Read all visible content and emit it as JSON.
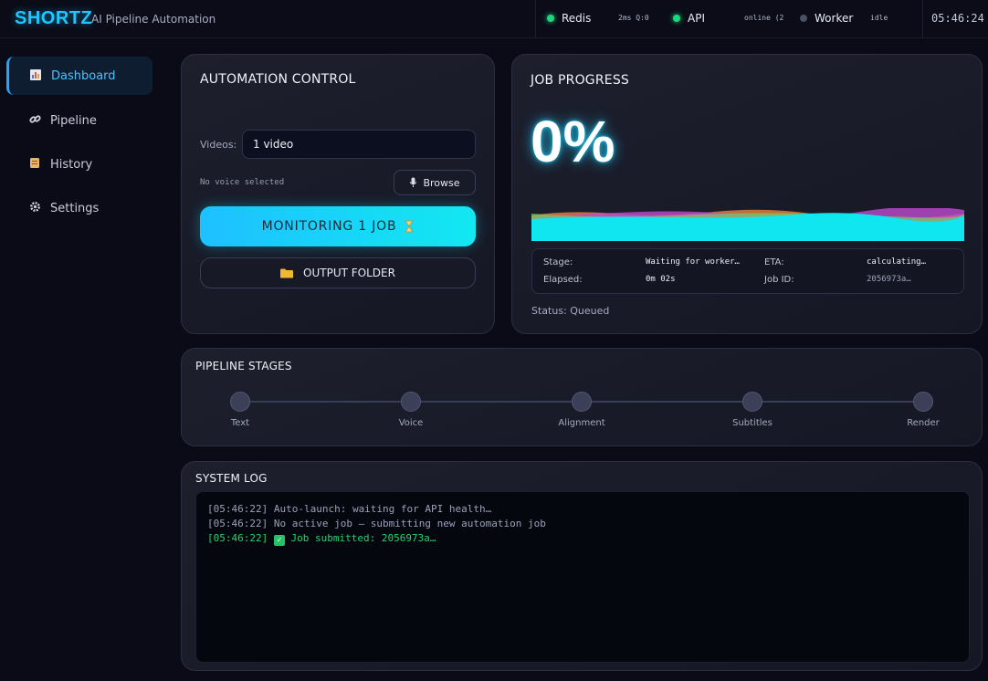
{
  "header": {
    "logo": "SHORTZ",
    "tagline": "AI Pipeline Automation",
    "services": [
      {
        "label": "Redis",
        "meta": "2ms  Q:0",
        "state": "online"
      },
      {
        "label": "API",
        "meta": "online (2",
        "state": "online"
      },
      {
        "label": "Worker",
        "meta": "idle",
        "state": "idle"
      }
    ],
    "clock": "05:46:24"
  },
  "sidebar": {
    "items": [
      {
        "label": "Dashboard",
        "icon": "chart-icon",
        "active": true
      },
      {
        "label": "Pipeline",
        "icon": "link-icon"
      },
      {
        "label": "History",
        "icon": "scroll-icon"
      },
      {
        "label": "Settings",
        "icon": "gear-icon"
      }
    ]
  },
  "automation": {
    "title": "AUTOMATION CONTROL",
    "videos_label": "Videos:",
    "videos_value": "1 video",
    "voice_note": "No voice selected",
    "browse_label": "Browse",
    "monitor_label": "MONITORING 1 JOB",
    "output_label": "OUTPUT FOLDER"
  },
  "job": {
    "title": "JOB PROGRESS",
    "percent": "0%",
    "stage_key": "Stage:",
    "stage_val": "Waiting for worker…",
    "eta_key": "ETA:",
    "eta_val": "calculating…",
    "elapsed_key": "Elapsed:",
    "elapsed_val": "0m 02s",
    "jobid_key": "Job ID:",
    "jobid_val": "2056973a…",
    "status": "Status: Queued"
  },
  "pipeline": {
    "title": "PIPELINE STAGES",
    "stages": [
      "Text",
      "Voice",
      "Alignment",
      "Subtitles",
      "Render"
    ]
  },
  "log": {
    "title": "SYSTEM LOG",
    "lines": [
      {
        "text": "[05:46:22] Auto-launch: waiting for API health…",
        "kind": "info"
      },
      {
        "text": "[05:46:22] No active job — submitting new automation job",
        "kind": "info"
      },
      {
        "prefix": "[05:46:22] ",
        "text": "Job submitted: 2056973a…",
        "kind": "success"
      }
    ]
  },
  "colors": {
    "accent": "#1ec8ff",
    "online": "#19d97a",
    "success": "#27d36b",
    "background": "#0a0b17"
  }
}
